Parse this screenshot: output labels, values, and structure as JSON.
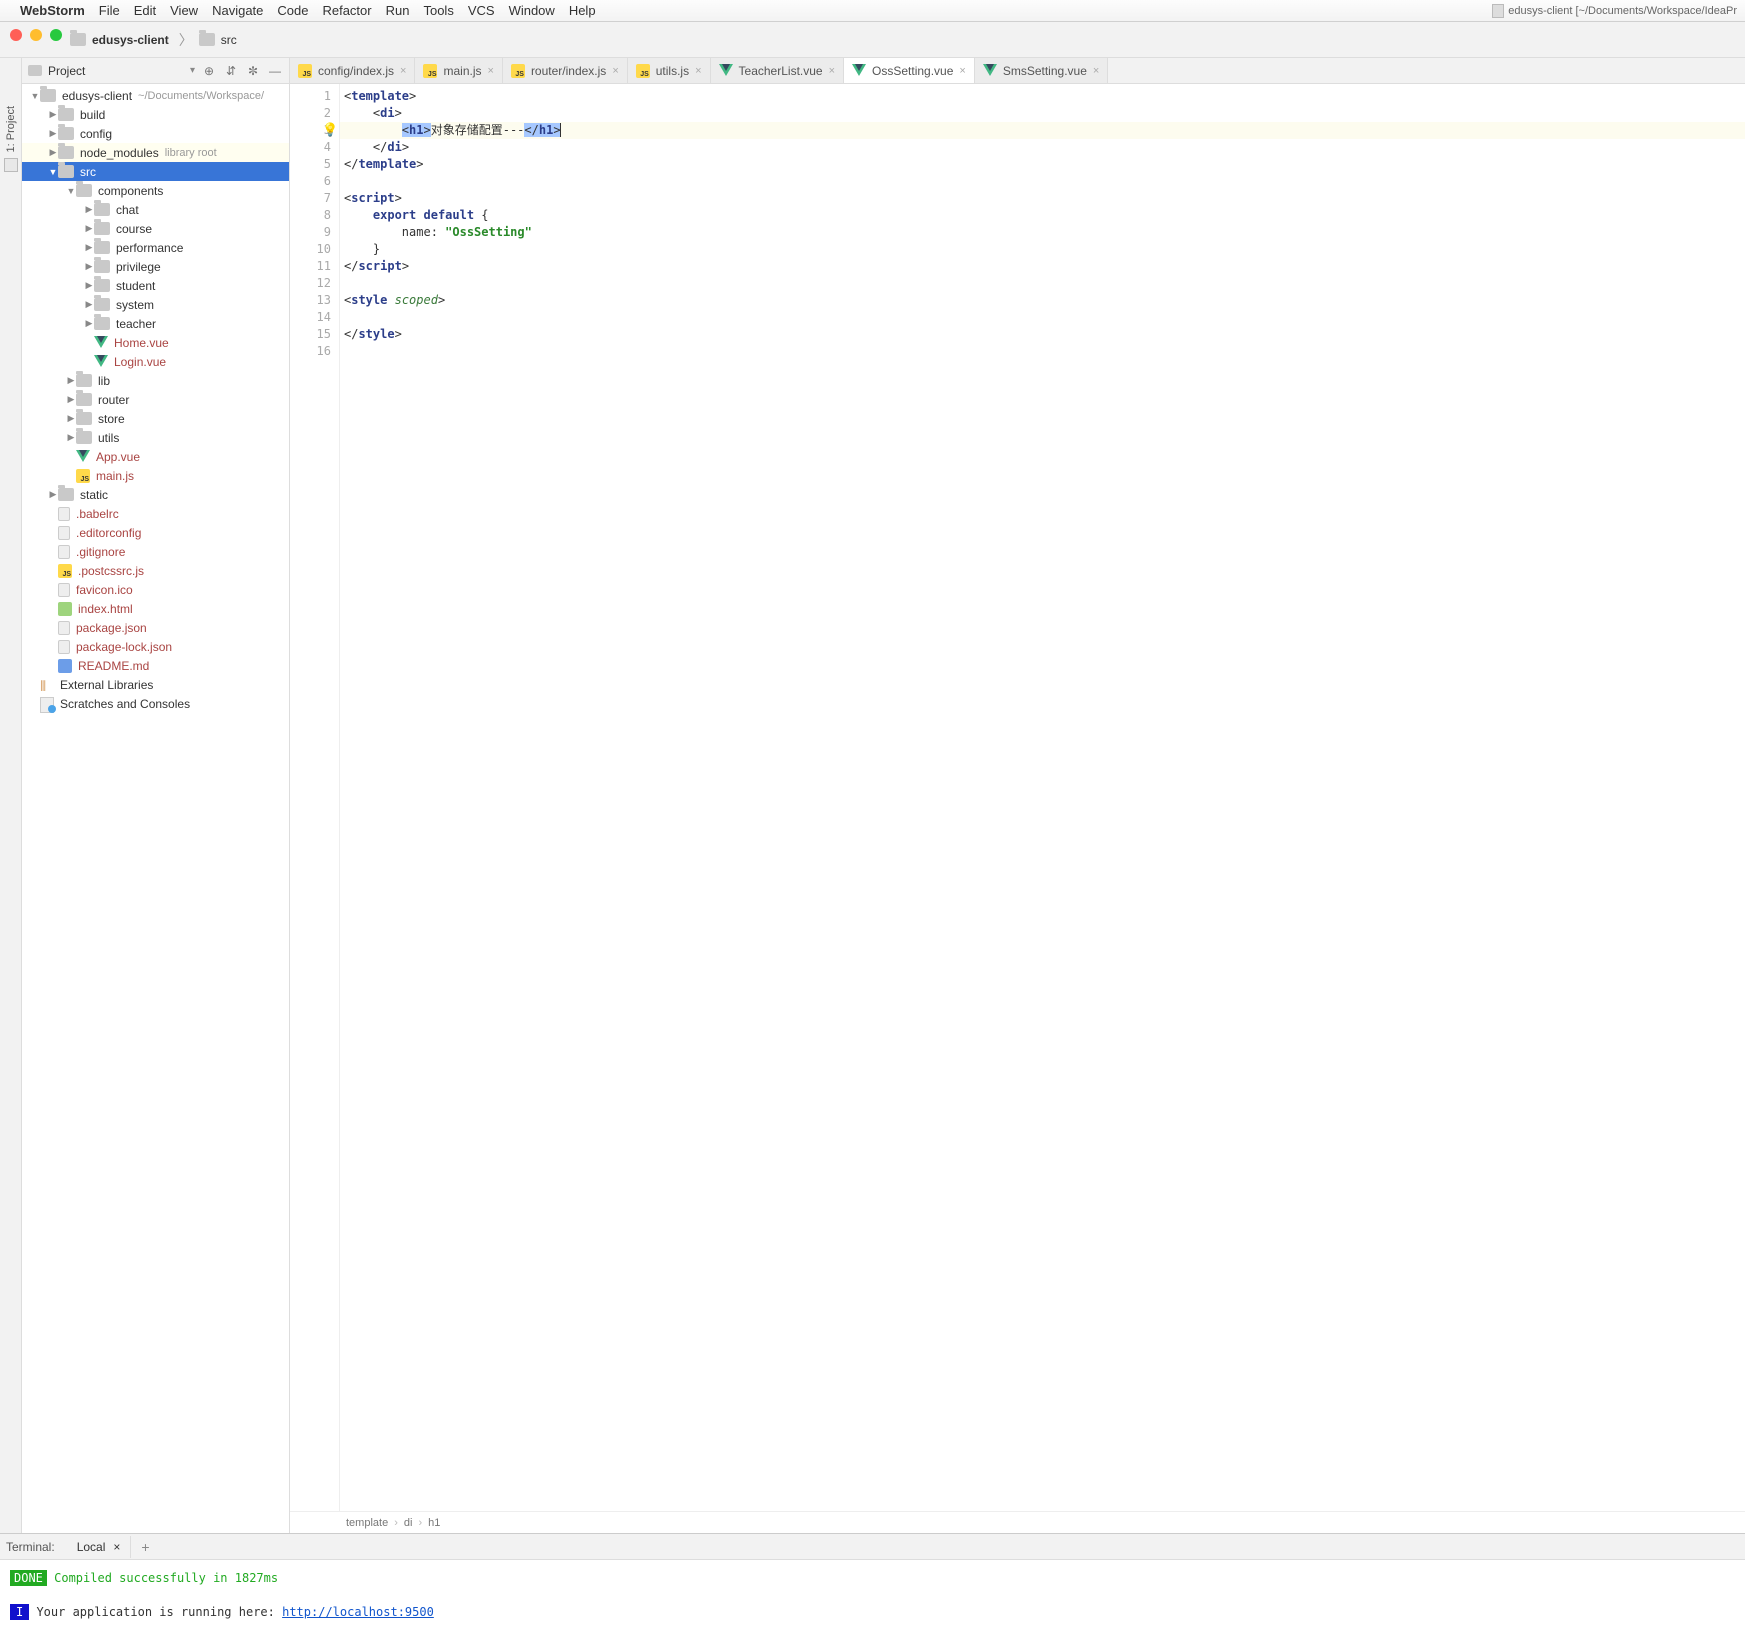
{
  "menubar": {
    "app": "WebStorm",
    "items": [
      "File",
      "Edit",
      "View",
      "Navigate",
      "Code",
      "Refactor",
      "Run",
      "Tools",
      "VCS",
      "Window",
      "Help"
    ],
    "project_tag": "edusys-client [~/Documents/Workspace/IdeaPr"
  },
  "breadcrumb": {
    "root": "edusys-client",
    "child": "src"
  },
  "sidebar": {
    "title": "Project",
    "tree": [
      {
        "indent": 0,
        "arrow": "open",
        "icon": "folder",
        "name": "edusys-client",
        "hint": "~/Documents/Workspace/"
      },
      {
        "indent": 1,
        "arrow": "closed",
        "icon": "folder",
        "name": "build"
      },
      {
        "indent": 1,
        "arrow": "closed",
        "icon": "folder",
        "name": "config"
      },
      {
        "indent": 1,
        "arrow": "closed",
        "icon": "folder",
        "name": "node_modules",
        "hint": "library root",
        "lib": true
      },
      {
        "indent": 1,
        "arrow": "open",
        "icon": "folder",
        "name": "src",
        "selected": true
      },
      {
        "indent": 2,
        "arrow": "open",
        "icon": "folder",
        "name": "components"
      },
      {
        "indent": 3,
        "arrow": "closed",
        "icon": "folder",
        "name": "chat"
      },
      {
        "indent": 3,
        "arrow": "closed",
        "icon": "folder",
        "name": "course"
      },
      {
        "indent": 3,
        "arrow": "closed",
        "icon": "folder",
        "name": "performance"
      },
      {
        "indent": 3,
        "arrow": "closed",
        "icon": "folder",
        "name": "privilege"
      },
      {
        "indent": 3,
        "arrow": "closed",
        "icon": "folder",
        "name": "student"
      },
      {
        "indent": 3,
        "arrow": "closed",
        "icon": "folder",
        "name": "system"
      },
      {
        "indent": 3,
        "arrow": "closed",
        "icon": "folder",
        "name": "teacher"
      },
      {
        "indent": 3,
        "arrow": "",
        "icon": "vue",
        "name": "Home.vue",
        "cls": "vuefile"
      },
      {
        "indent": 3,
        "arrow": "",
        "icon": "vue",
        "name": "Login.vue",
        "cls": "vuefile"
      },
      {
        "indent": 2,
        "arrow": "closed",
        "icon": "folder",
        "name": "lib"
      },
      {
        "indent": 2,
        "arrow": "closed",
        "icon": "folder",
        "name": "router"
      },
      {
        "indent": 2,
        "arrow": "closed",
        "icon": "folder",
        "name": "store"
      },
      {
        "indent": 2,
        "arrow": "closed",
        "icon": "folder",
        "name": "utils"
      },
      {
        "indent": 2,
        "arrow": "",
        "icon": "vue",
        "name": "App.vue",
        "cls": "vuefile"
      },
      {
        "indent": 2,
        "arrow": "",
        "icon": "js",
        "name": "main.js",
        "cls": "codefile"
      },
      {
        "indent": 1,
        "arrow": "closed",
        "icon": "folder",
        "name": "static"
      },
      {
        "indent": 1,
        "arrow": "",
        "icon": "file",
        "name": ".babelrc",
        "cls": "codefile"
      },
      {
        "indent": 1,
        "arrow": "",
        "icon": "file",
        "name": ".editorconfig",
        "cls": "codefile"
      },
      {
        "indent": 1,
        "arrow": "",
        "icon": "file",
        "name": ".gitignore",
        "cls": "codefile"
      },
      {
        "indent": 1,
        "arrow": "",
        "icon": "js",
        "name": ".postcssrc.js",
        "cls": "codefile"
      },
      {
        "indent": 1,
        "arrow": "",
        "icon": "file",
        "name": "favicon.ico",
        "cls": "codefile"
      },
      {
        "indent": 1,
        "arrow": "",
        "icon": "html",
        "name": "index.html",
        "cls": "codefile"
      },
      {
        "indent": 1,
        "arrow": "",
        "icon": "json",
        "name": "package.json",
        "cls": "codefile"
      },
      {
        "indent": 1,
        "arrow": "",
        "icon": "json",
        "name": "package-lock.json",
        "cls": "codefile"
      },
      {
        "indent": 1,
        "arrow": "",
        "icon": "md",
        "name": "README.md",
        "cls": "codefile"
      },
      {
        "indent": 0,
        "arrow": "",
        "icon": "lib",
        "name": "External Libraries"
      },
      {
        "indent": 0,
        "arrow": "",
        "icon": "scratch",
        "name": "Scratches and Consoles"
      }
    ]
  },
  "tabs": [
    {
      "icon": "js",
      "name": "config/index.js"
    },
    {
      "icon": "js",
      "name": "main.js"
    },
    {
      "icon": "js",
      "name": "router/index.js"
    },
    {
      "icon": "js",
      "name": "utils.js"
    },
    {
      "icon": "vue",
      "name": "TeacherList.vue"
    },
    {
      "icon": "vue",
      "name": "OssSetting.vue",
      "active": true
    },
    {
      "icon": "vue",
      "name": "SmsSetting.vue"
    }
  ],
  "code": {
    "lines": 16,
    "l1": {
      "p": "<",
      "t1": "template",
      "s": ">"
    },
    "l2": {
      "p": "    <",
      "t1": "di",
      "s": ">"
    },
    "l3": {
      "p": "        ",
      "o1": "<",
      "t1": "h1",
      "o2": ">",
      "txt": "对象存储配置---",
      "c1": "</",
      "t2": "h1",
      "c2": ">"
    },
    "l4": {
      "p": "    </",
      "t1": "di",
      "s": ">"
    },
    "l5": {
      "p": "</",
      "t1": "template",
      "s": ">"
    },
    "l7": {
      "p": "<",
      "t1": "script",
      "s": ">"
    },
    "l8": {
      "p": "    ",
      "k1": "export",
      "sp": " ",
      "k2": "default",
      "rest": " {"
    },
    "l9": {
      "p": "        name: ",
      "str": "\"OssSetting\""
    },
    "l10": {
      "p": "    }"
    },
    "l11": {
      "p": "</",
      "t1": "script",
      "s": ">"
    },
    "l13": {
      "p": "<",
      "t1": "style",
      "sp": " ",
      "a": "scoped",
      "s": ">"
    },
    "l15": {
      "p": "</",
      "t1": "style",
      "s": ">"
    }
  },
  "crumbs": [
    "template",
    "di",
    "h1"
  ],
  "terminal": {
    "label": "Terminal:",
    "tab": "Local",
    "done": "DONE",
    "compiled": " Compiled successfully in 1827ms",
    "info": "I",
    "running": " Your application is running here: ",
    "url": "http://localhost:9500"
  },
  "leftgutter": {
    "label": "1: Project"
  }
}
